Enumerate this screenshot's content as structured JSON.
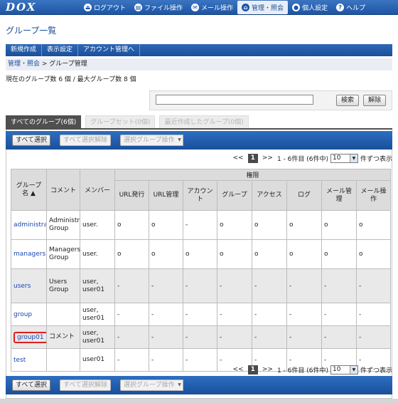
{
  "app": {
    "logo": "DOX",
    "nav": [
      {
        "label": "ログアウト",
        "icon": "logout-icon",
        "glyph": "⏏"
      },
      {
        "label": "ファイル操作",
        "icon": "file-icon",
        "glyph": "▤"
      },
      {
        "label": "メール操作",
        "icon": "mail-icon",
        "glyph": "✉"
      },
      {
        "label": "管理・照会",
        "icon": "admin-icon",
        "glyph": "⌂",
        "active": true
      },
      {
        "label": "個人設定",
        "icon": "user-icon",
        "glyph": "●"
      },
      {
        "label": "ヘルプ",
        "icon": "help-icon",
        "glyph": "?"
      }
    ]
  },
  "page": {
    "title": "グループ一覧",
    "menu": [
      "新規作成",
      "表示設定",
      "アカウント管理へ"
    ],
    "breadcrumb": {
      "link": "管理・照会",
      "sep": " > ",
      "current": "グループ管理"
    },
    "count_text": "現在のグループ数 6 個 / 最大グループ数 8 個"
  },
  "search": {
    "value": "",
    "placeholder": "",
    "search_label": "検索",
    "clear_label": "解除"
  },
  "tabs": [
    {
      "label": "すべてのグループ(6個)",
      "active": true
    },
    {
      "label": "グループセット(0個)",
      "active": false
    },
    {
      "label": "最近作成したグループ(0個)",
      "active": false
    }
  ],
  "actions": {
    "select_all": "すべて選択",
    "deselect_all": "すべて選択解除",
    "group_op": "選択グループ操作"
  },
  "pager": {
    "prev": "<<",
    "current": "1",
    "next": ">>",
    "range": "1 - 6件目 (6件中)",
    "per_page": "10",
    "suffix": "件ずつ表示"
  },
  "table": {
    "permission_header": "権限",
    "col_name": "グループ名",
    "col_comment": "コメント",
    "col_members": "メンバー",
    "permissions": [
      "URL発行",
      "URL管理",
      "アカウント",
      "グループ",
      "アクセス",
      "ログ",
      "メール管理",
      "メール操作"
    ],
    "rows": [
      {
        "name": "administra",
        "comment": "Administr Group",
        "members": "user.",
        "perms": [
          "o",
          "o",
          "-",
          "o",
          "o",
          "o",
          "o",
          "o"
        ]
      },
      {
        "name": "managers",
        "comment": "Managers Group",
        "members": "user.",
        "perms": [
          "o",
          "o",
          "o",
          "o",
          "o",
          "o",
          "o",
          "o"
        ]
      },
      {
        "name": "users",
        "comment": "Users Group",
        "members": "user, user01",
        "perms": [
          "-",
          "-",
          "-",
          "-",
          "-",
          "-",
          "-",
          "-"
        ]
      },
      {
        "name": "group",
        "comment": "",
        "members": "user, user01",
        "perms": [
          "-",
          "-",
          "-",
          "-",
          "-",
          "-",
          "-",
          "-"
        ]
      },
      {
        "name": "group01",
        "comment": "コメント",
        "members": "user, user01",
        "perms": [
          "-",
          "-",
          "-",
          "-",
          "-",
          "-",
          "-",
          "-"
        ],
        "highlight": true
      },
      {
        "name": "test",
        "comment": "",
        "members": "user01",
        "perms": [
          "-",
          "-",
          "-",
          "-",
          "-",
          "-",
          "-",
          "-"
        ]
      }
    ]
  },
  "colors": {
    "brand": "#1d55a5",
    "highlight": "#e51b1b",
    "link": "#1b47b0"
  }
}
